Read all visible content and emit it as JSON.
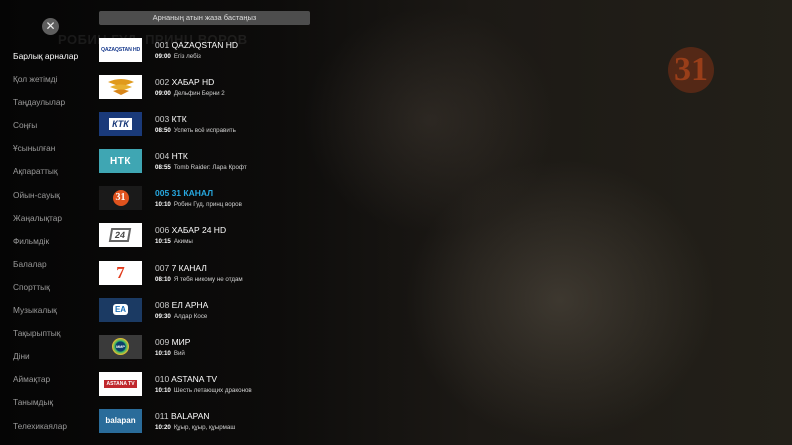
{
  "background": {
    "title": "РОБИН ГУД, ПРИНЦ ВОРОВ",
    "logo_text": "31"
  },
  "search": {
    "placeholder": "Арнаның атын жаза бастаңыз"
  },
  "close_icon": "close-icon",
  "sidebar": {
    "items": [
      {
        "label": "Барлық арналар",
        "active": true
      },
      {
        "label": "Қол жетімді"
      },
      {
        "label": "Таңдаулылар"
      },
      {
        "label": "Соңғы"
      },
      {
        "label": "Ұсынылған"
      },
      {
        "label": "Ақпараттық"
      },
      {
        "label": "Ойын-сауық"
      },
      {
        "label": "Жаңалықтар"
      },
      {
        "label": "Фильмдік"
      },
      {
        "label": "Балалар"
      },
      {
        "label": "Спорттық"
      },
      {
        "label": "Музыкалық"
      },
      {
        "label": "Тақырыптық"
      },
      {
        "label": "Діни"
      },
      {
        "label": "Аймақтар"
      },
      {
        "label": "Танымдық"
      },
      {
        "label": "Телехикаялар"
      }
    ]
  },
  "channels": [
    {
      "num": "001",
      "name": "QAZAQSTAN HD",
      "time": "09:00",
      "program": "Егіз лебіз",
      "logo_text": "QAZAQSTAN HD"
    },
    {
      "num": "002",
      "name": "ХАБАР HD",
      "time": "09:00",
      "program": "Дельфин Берни 2",
      "logo_text": ""
    },
    {
      "num": "003",
      "name": "КТК",
      "time": "08:50",
      "program": "Успеть всё исправить",
      "logo_text": "КТК"
    },
    {
      "num": "004",
      "name": "НТК",
      "time": "08:55",
      "program": "Tomb Raider: Лара Крофт",
      "logo_text": "НТК"
    },
    {
      "num": "005",
      "name": "31 КАНАЛ",
      "time": "10:10",
      "program": "Робин Гуд, принц воров",
      "logo_text": "31",
      "selected": true
    },
    {
      "num": "006",
      "name": "ХАБАР 24 HD",
      "time": "10:15",
      "program": "Акимы",
      "logo_text": "24"
    },
    {
      "num": "007",
      "name": "7 КАНАЛ",
      "time": "08:10",
      "program": "Я тебя никому не отдам",
      "logo_text": "7"
    },
    {
      "num": "008",
      "name": "ЕЛ АРНА",
      "time": "09:30",
      "program": "Алдар Косе",
      "logo_text": "ЕА"
    },
    {
      "num": "009",
      "name": "МИР",
      "time": "10:10",
      "program": "Вий",
      "logo_text": "МИР"
    },
    {
      "num": "010",
      "name": "ASTANA TV",
      "time": "10:10",
      "program": "Шесть летающих драконов",
      "logo_text": "ASTANA TV"
    },
    {
      "num": "011",
      "name": "BALAPAN",
      "time": "10:20",
      "program": "Құыр, құыр, құырмаш",
      "logo_text": "balapan"
    }
  ]
}
